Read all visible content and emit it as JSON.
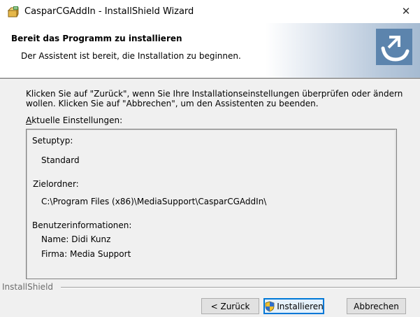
{
  "window": {
    "title": "CasparCGAddIn - InstallShield Wizard",
    "close_glyph": "✕",
    "app_icon": "installer-box-icon"
  },
  "header": {
    "title": "Bereit das Programm zu installieren",
    "subtitle": "Der Assistent ist bereit, die Installation zu beginnen.",
    "brand_icon": "installshield-arrow-icon"
  },
  "body": {
    "instructions_line1": "Klicken Sie auf \"Zurück\", wenn Sie Ihre Installationseinstellungen überprüfen oder ändern",
    "instructions_line2": "wollen. Klicken Sie auf \"Abbrechen\", um den Assistenten zu beenden.",
    "settings_label_accel": "A",
    "settings_label_rest": "ktuelle Einstellungen:"
  },
  "settings": {
    "setup_type_label": "Setuptyp:",
    "setup_type_value": "Standard",
    "target_folder_label": "Zielordner:",
    "target_folder_value": "C:\\Program Files (x86)\\MediaSupport\\CasparCGAddIn\\",
    "user_info_label": "Benutzerinformationen:",
    "user_name": "Name: Didi Kunz",
    "user_company": "Firma: Media Support"
  },
  "footer": {
    "brand": "InstallShield",
    "back_label": "< Zurück",
    "install_label": "Installieren",
    "cancel_label": "Abbrechen"
  },
  "colors": {
    "accent": "#0078d7",
    "banner": "#a6bbd2",
    "brand_tile": "#5c84ad"
  }
}
